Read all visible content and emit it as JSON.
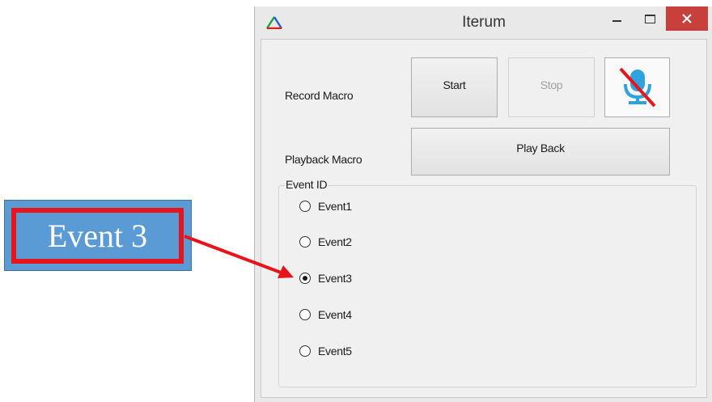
{
  "window": {
    "title": "Iterum",
    "close_glyph": "✕",
    "accent_close": "#c8403c"
  },
  "record": {
    "label": "Record Macro",
    "start_label": "Start",
    "stop_label": "Stop",
    "mic_icon": "microphone-muted-icon"
  },
  "playback": {
    "label": "Playback Macro",
    "button_label": "Play Back"
  },
  "event_group": {
    "caption": "Event ID",
    "options": [
      {
        "label": "Event1",
        "checked": false
      },
      {
        "label": "Event2",
        "checked": false
      },
      {
        "label": "Event3",
        "checked": true
      },
      {
        "label": "Event4",
        "checked": false
      },
      {
        "label": "Event5",
        "checked": false
      }
    ]
  },
  "annotation": {
    "text": "Event 3",
    "fill": "#5b9bd5",
    "border": "#e8141c",
    "arrow_color": "#e8141c"
  }
}
